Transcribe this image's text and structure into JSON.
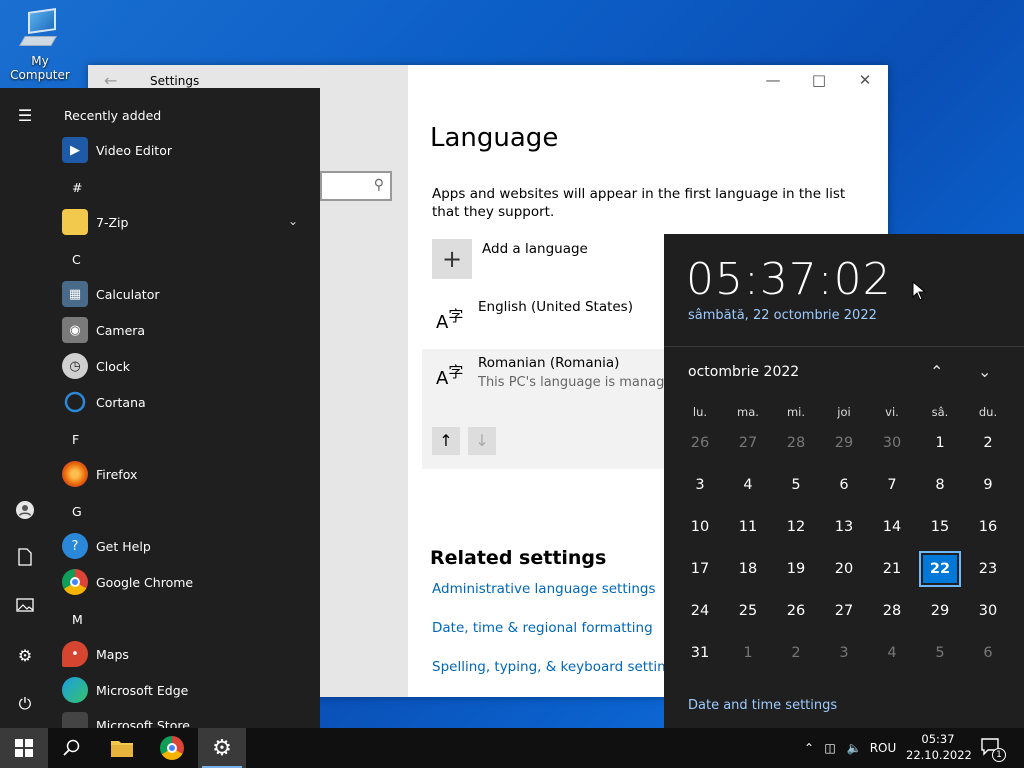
{
  "desktop": {
    "icon_label": "My Computer"
  },
  "settings": {
    "window_title": "Settings",
    "heading": "Language",
    "description": "Apps and websites will appear in the first language in the list that they support.",
    "add_language": "Add a language",
    "languages": [
      {
        "name": "English (United States)",
        "sub": ""
      },
      {
        "name": "Romanian (Romania)",
        "sub": "This PC's language is managed"
      }
    ],
    "related_title": "Related settings",
    "related_links": [
      "Administrative language settings",
      "Date, time & regional formatting",
      "Spelling, typing, & keyboard settings"
    ]
  },
  "start_menu": {
    "recently_added": "Recently added",
    "apps": [
      {
        "name": "Video Editor",
        "icon": "video-editor-icon",
        "color": "#1e5aa8"
      },
      {
        "letter": "#"
      },
      {
        "name": "7-Zip",
        "icon": "folder-icon",
        "color": "#f2c94c"
      },
      {
        "letter": "C"
      },
      {
        "name": "Calculator",
        "icon": "calculator-icon",
        "color": "#4a6a8a"
      },
      {
        "name": "Camera",
        "icon": "camera-icon",
        "color": "#7a7a7a"
      },
      {
        "name": "Clock",
        "icon": "clock-icon",
        "color": "#d0d0d0"
      },
      {
        "name": "Cortana",
        "icon": "cortana-icon",
        "color": "#1f1f1f"
      },
      {
        "letter": "F"
      },
      {
        "name": "Firefox",
        "icon": "firefox-icon",
        "color": "#e66000"
      },
      {
        "letter": "G"
      },
      {
        "name": "Get Help",
        "icon": "get-help-icon",
        "color": "#2b88d8"
      },
      {
        "name": "Google Chrome",
        "icon": "chrome-icon",
        "color": "#db4437"
      },
      {
        "letter": "M"
      },
      {
        "name": "Maps",
        "icon": "maps-icon",
        "color": "#d5452f"
      },
      {
        "name": "Microsoft Edge",
        "icon": "edge-icon",
        "color": "#1b9de2"
      },
      {
        "name": "Microsoft Store",
        "icon": "store-icon",
        "color": "#444444"
      }
    ]
  },
  "flyout": {
    "time": "05:37:02",
    "date": "sâmbătă, 22 octombrie 2022",
    "month": "octombrie 2022",
    "weekdays": [
      "lu.",
      "ma.",
      "mi.",
      "joi",
      "vi.",
      "sâ.",
      "du."
    ],
    "weeks": [
      [
        "26",
        "27",
        "28",
        "29",
        "30",
        "1",
        "2"
      ],
      [
        "3",
        "4",
        "5",
        "6",
        "7",
        "8",
        "9"
      ],
      [
        "10",
        "11",
        "12",
        "13",
        "14",
        "15",
        "16"
      ],
      [
        "17",
        "18",
        "19",
        "20",
        "21",
        "22",
        "23"
      ],
      [
        "24",
        "25",
        "26",
        "27",
        "28",
        "29",
        "30"
      ],
      [
        "31",
        "1",
        "2",
        "3",
        "4",
        "5",
        "6"
      ]
    ],
    "today": "22",
    "settings_link": "Date and time settings"
  },
  "taskbar": {
    "lang": "ROU",
    "time": "05:37",
    "date": "22.10.2022",
    "notification_count": "1"
  },
  "colors": {
    "accent": "#0078d7",
    "link": "#0067b8",
    "flyout_link": "#9ecbff"
  }
}
